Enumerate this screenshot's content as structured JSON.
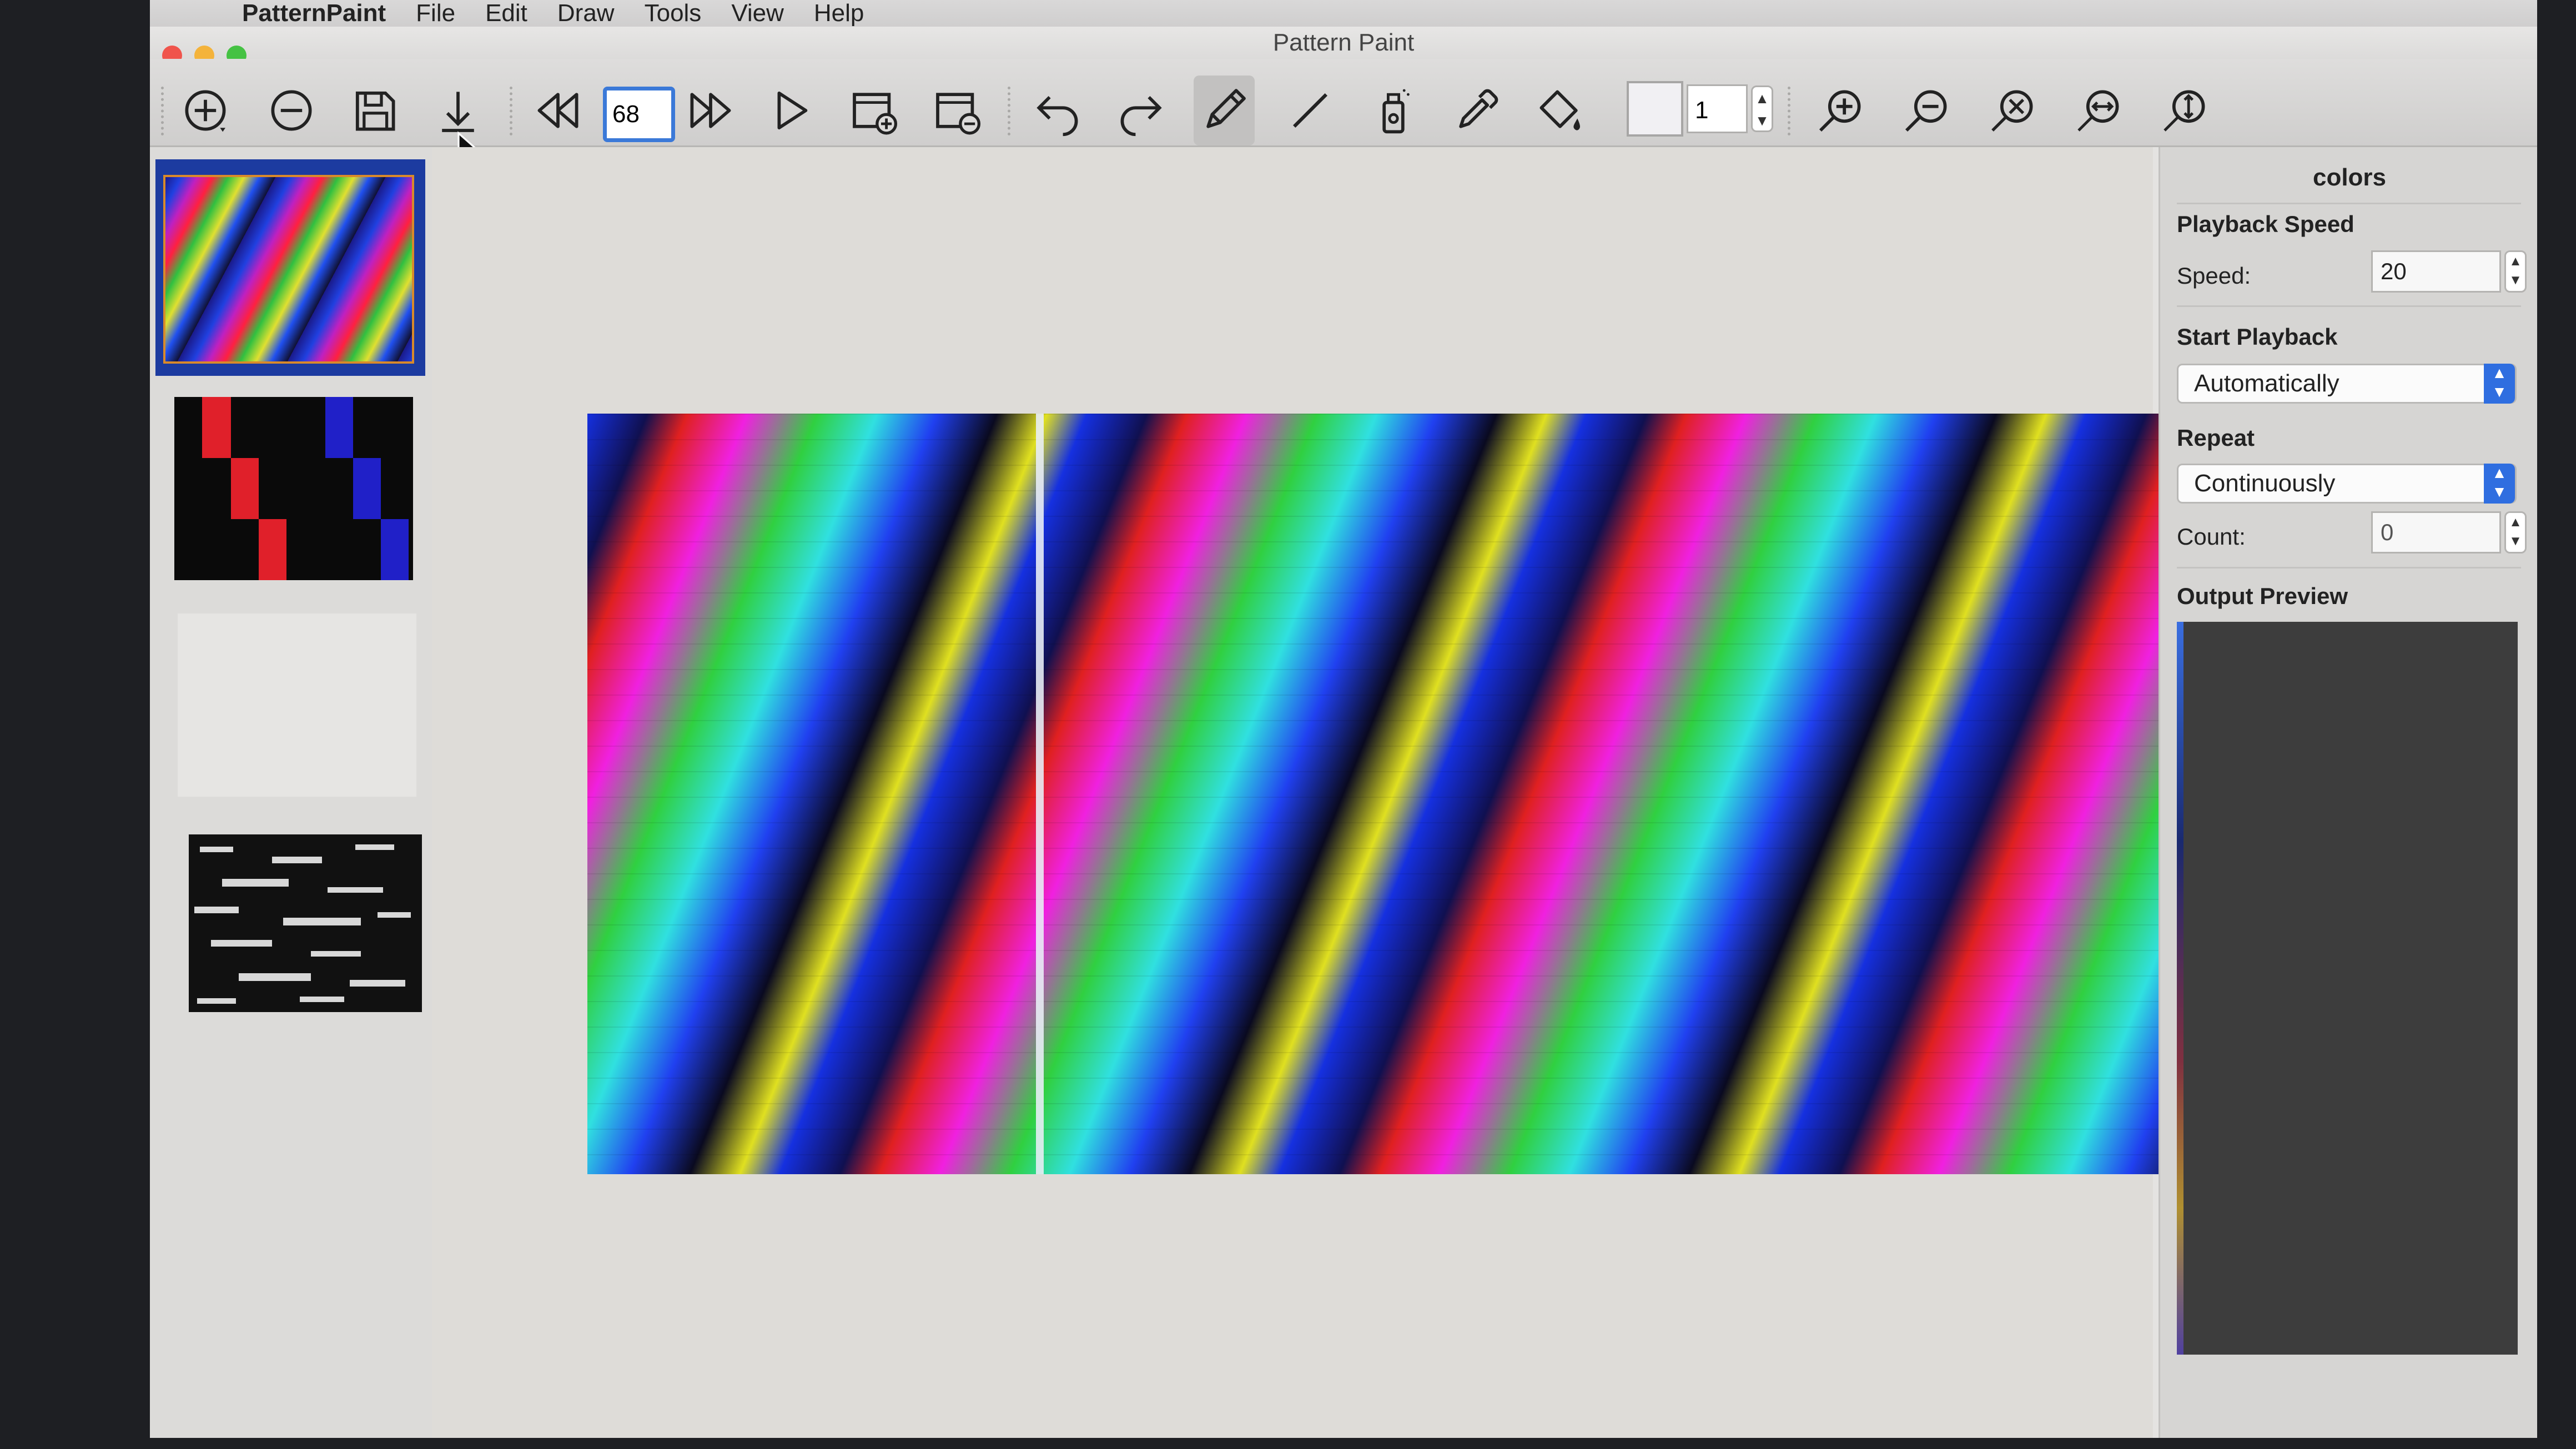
{
  "menubar": {
    "apple": "",
    "app_name": "PatternPaint",
    "items": [
      "File",
      "Edit",
      "Draw",
      "Tools",
      "View",
      "Help"
    ]
  },
  "window": {
    "title": "Pattern Paint"
  },
  "toolbar": {
    "frame_value": "68",
    "stroke_size": "1",
    "buttons": [
      "add-icon",
      "remove-icon",
      "save-icon",
      "download-icon",
      "rewind-icon",
      "fast-forward-icon",
      "play-icon",
      "add-frame-icon",
      "delete-frame-icon",
      "undo-icon",
      "redo-icon",
      "pencil-icon",
      "line-icon",
      "spray-icon",
      "eyedropper-icon",
      "fill-icon",
      "zoom-in-icon",
      "zoom-out-icon",
      "zoom-fit-icon",
      "zoom-width-icon",
      "zoom-height-icon"
    ],
    "active_tool": "pencil-icon",
    "color_well": "#f1f0f3"
  },
  "inspector": {
    "title": "colors",
    "playback_speed_heading": "Playback Speed",
    "speed_label": "Speed:",
    "speed_value": "20",
    "start_playback_heading": "Start Playback",
    "start_playback_value": "Automatically",
    "repeat_heading": "Repeat",
    "repeat_value": "Continuously",
    "count_label": "Count:",
    "count_value": "0",
    "output_preview_heading": "Output Preview"
  },
  "colors": {
    "accent": "#2f6ee0",
    "selection": "#1c3ba0"
  }
}
